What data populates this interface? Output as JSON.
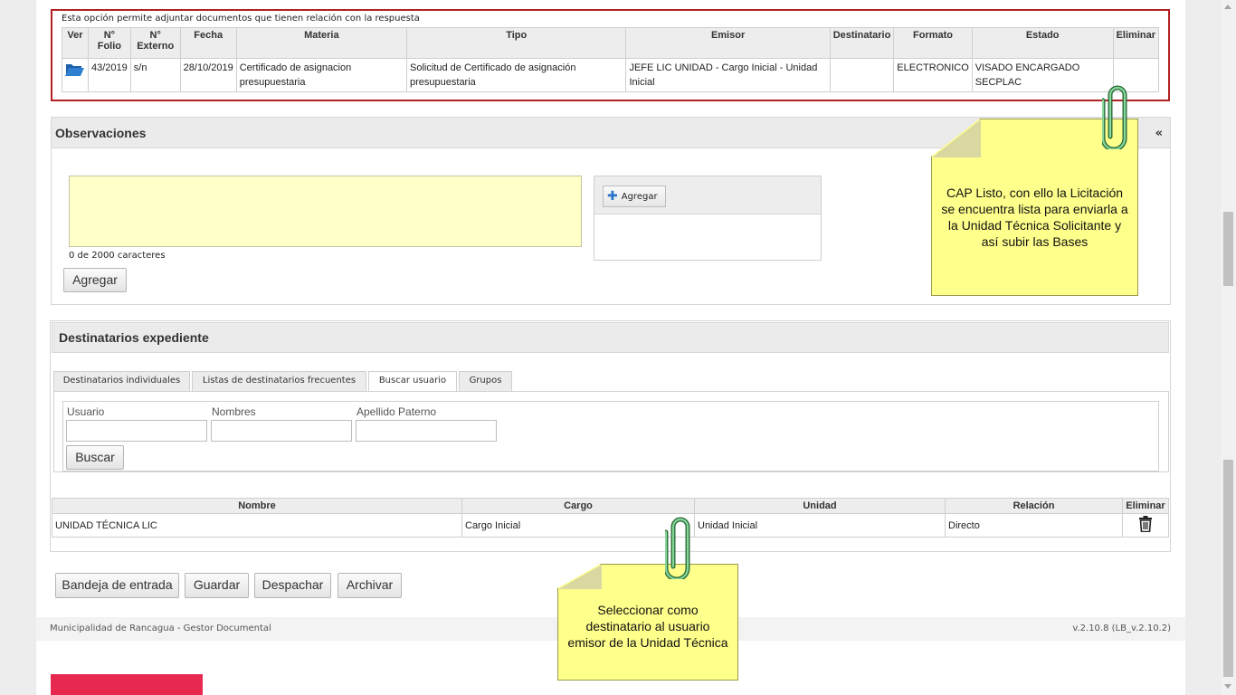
{
  "documents": {
    "note": "Esta opción permite adjuntar documentos que tienen relación con la respuesta",
    "headers": {
      "ver": "Ver",
      "folio": "N° Folio",
      "externo": "N° Externo",
      "fecha": "Fecha",
      "materia": "Materia",
      "tipo": "Tipo",
      "emisor": "Emisor",
      "destinatario": "Destinatario",
      "formato": "Formato",
      "estado": "Estado",
      "eliminar": "Eliminar"
    },
    "row": {
      "folio": "43/2019",
      "externo": "s/n",
      "fecha": "28/10/2019",
      "materia": "Certificado de asignacion presupuestaria",
      "tipo": "Solicitud de Certificado de asignación presupuestaria",
      "emisor": "JEFE LIC UNIDAD - Cargo Inicial - Unidad Inicial",
      "destinatario": "",
      "formato": "ELECTRONICO",
      "estado": "VISADO ENCARGADO SECPLAC"
    }
  },
  "observaciones": {
    "title": "Observaciones",
    "collapse": "«",
    "char_count": "0 de 2000 caracteres",
    "add_button": "Agregar",
    "attach_button": "Agregar"
  },
  "destinatarios": {
    "title": "Destinatarios expediente",
    "tabs": [
      "Destinatarios individuales",
      "Listas de destinatarios frecuentes",
      "Buscar usuario",
      "Grupos"
    ],
    "fields": {
      "usuario": "Usuario",
      "nombres": "Nombres",
      "apellido": "Apellido Paterno"
    },
    "search_button": "Buscar",
    "headers": {
      "nombre": "Nombre",
      "cargo": "Cargo",
      "unidad": "Unidad",
      "relacion": "Relación",
      "eliminar": "Eliminar"
    },
    "row": {
      "nombre": "UNIDAD TÉCNICA LIC",
      "cargo": "Cargo Inicial",
      "unidad": "Unidad Inicial",
      "relacion": "Directo"
    }
  },
  "actions": {
    "bandeja": "Bandeja de entrada",
    "guardar": "Guardar",
    "despachar": "Despachar",
    "archivar": "Archivar"
  },
  "footer": {
    "left": "Municipalidad de Rancagua - Gestor Documental",
    "right": "v.2.10.8 (LB_v.2.10.2)"
  },
  "notes": {
    "note1": "CAP Listo, con ello la Licitación se encuentra lista para enviarla a la Unidad Técnica Solicitante y así subir las Bases",
    "note2": "Seleccionar como destinatario al usuario emisor de la Unidad Técnica"
  },
  "colors": {
    "accent_red": "#e8294f",
    "note_yellow": "#ffff8c",
    "border_red": "#b22222",
    "textarea_bg": "#ffffc8"
  }
}
